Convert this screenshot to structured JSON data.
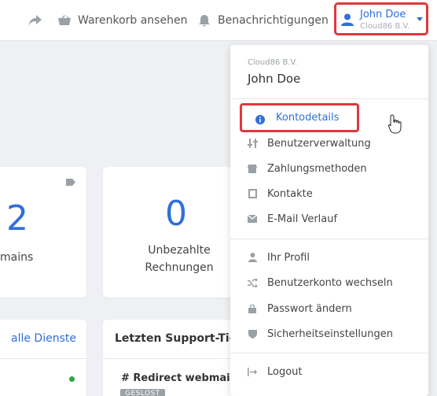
{
  "topbar": {
    "cart_label": "Warenkorb ansehen",
    "notifications_label": "Benachrichtigungen",
    "user": {
      "name": "John Doe",
      "company": "Cloud86 B.V."
    }
  },
  "cards": {
    "domains": {
      "count": "2",
      "label": "mains"
    },
    "invoices": {
      "count": "0",
      "label_line1": "Unbezahlte",
      "label_line2": "Rechnungen"
    },
    "services": {
      "link": "alle Dienste"
    },
    "tickets": {
      "title": "Letzten Support-Tick",
      "item": "# Redirect webmail n",
      "badge": "GESLOST"
    }
  },
  "dropdown": {
    "company": "Cloud86 B.V.",
    "name": "John Doe",
    "items": [
      {
        "label": "Kontodetails",
        "icon": "info-icon",
        "active": true
      },
      {
        "label": "Benutzerverwaltung",
        "icon": "sliders-icon"
      },
      {
        "label": "Zahlungsmethoden",
        "icon": "wallet-icon"
      },
      {
        "label": "Kontakte",
        "icon": "contact-card-icon"
      },
      {
        "label": "E-Mail Verlauf",
        "icon": "envelope-icon"
      },
      {
        "label": "Ihr Profil",
        "icon": "user-icon"
      },
      {
        "label": "Benutzerkonto wechseln",
        "icon": "shuffle-icon"
      },
      {
        "label": "Passwort ändern",
        "icon": "lock-icon"
      },
      {
        "label": "Sicherheitseinstellungen",
        "icon": "shield-icon"
      },
      {
        "label": "Logout",
        "icon": "logout-icon"
      }
    ]
  },
  "colors": {
    "accent": "#2f6fdb",
    "highlight": "#e0383e",
    "status_green": "#29a745"
  }
}
